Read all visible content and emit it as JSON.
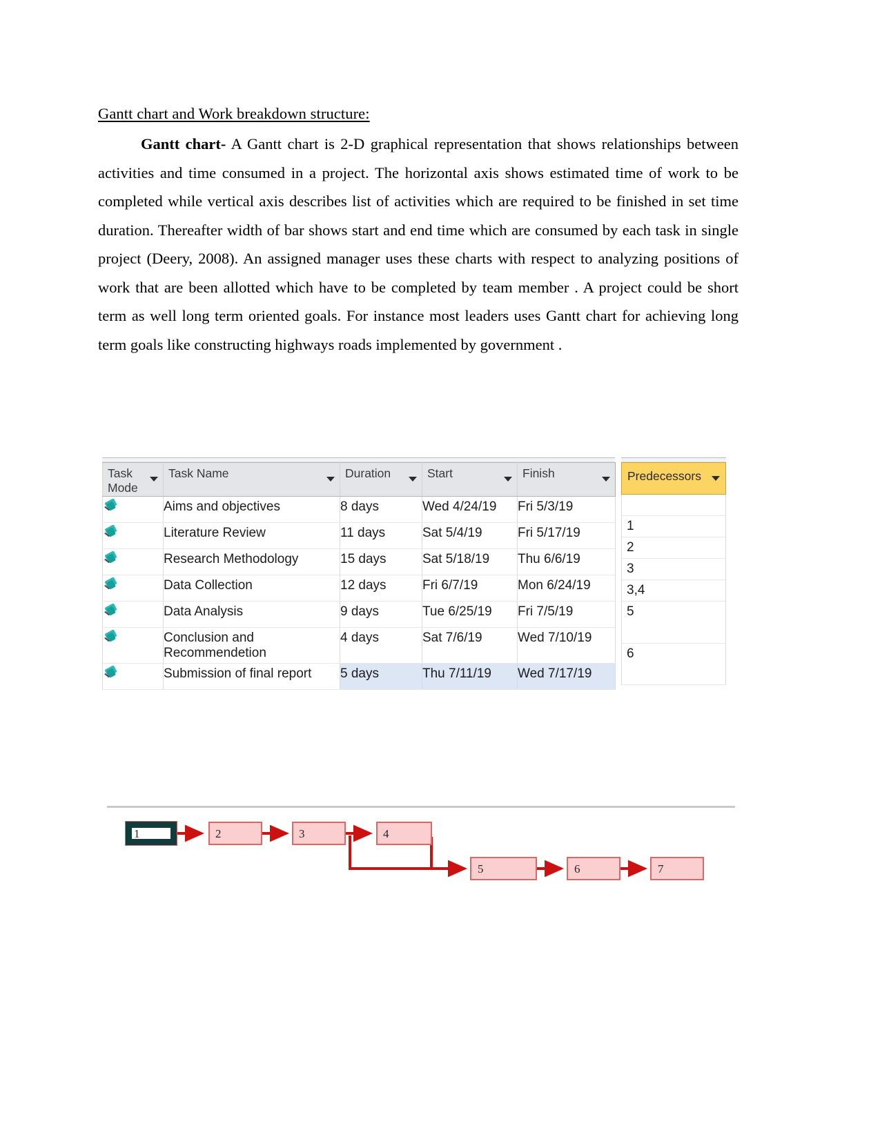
{
  "document": {
    "heading": "Gantt chart and Work breakdown structure:",
    "paragraph_lead_in": "Gantt chart-",
    "paragraph_body": "  A Gantt chart is 2-D graphical representation that shows  relationships between activities   and time consumed in a project. The horizontal axis shows estimated time of work to be completed while  vertical axis describes list of activities which are required  to be finished in set time duration. Thereafter width of bar shows start and end  time which are consumed by each task  in single project (Deery, 2008). An assigned manager uses these charts with respect to analyzing positions of work that are been allotted which have to be completed by team member . A project could be short term as well long term oriented goals. For instance most leaders uses Gantt chart for achieving long term goals like constructing highways roads implemented by government ."
  },
  "gantt_table": {
    "columns": [
      {
        "key": "task_mode",
        "label": "Task\nMode",
        "highlighted": false,
        "has_filter": true
      },
      {
        "key": "task_name",
        "label": "Task Name",
        "highlighted": false,
        "has_filter": true
      },
      {
        "key": "duration",
        "label": "Duration",
        "highlighted": false,
        "has_filter": true
      },
      {
        "key": "start",
        "label": "Start",
        "highlighted": false,
        "has_filter": true
      },
      {
        "key": "finish",
        "label": "Finish",
        "highlighted": true,
        "has_filter": true
      }
    ],
    "predecessors_column": {
      "label": "Predecessors",
      "highlighted": true,
      "has_filter": true
    },
    "rows": [
      {
        "mode_icon": "pushpin-icon",
        "task_name": "Aims and objectives",
        "duration": "8 days",
        "start": "Wed 4/24/19",
        "finish": "Fri 5/3/19",
        "predecessors": "",
        "selected": false
      },
      {
        "mode_icon": "pushpin-icon",
        "task_name": "Literature Review",
        "duration": "11 days",
        "start": "Sat 5/4/19",
        "finish": "Fri 5/17/19",
        "predecessors": "1",
        "selected": false
      },
      {
        "mode_icon": "pushpin-icon",
        "task_name": "Research Methodology",
        "duration": "15 days",
        "start": "Sat 5/18/19",
        "finish": "Thu 6/6/19",
        "predecessors": "2",
        "selected": false
      },
      {
        "mode_icon": "pushpin-icon",
        "task_name": "Data Collection",
        "duration": "12 days",
        "start": "Fri 6/7/19",
        "finish": "Mon 6/24/19",
        "predecessors": "3",
        "selected": false
      },
      {
        "mode_icon": "pushpin-icon",
        "task_name": "Data Analysis",
        "duration": "9 days",
        "start": "Tue 6/25/19",
        "finish": "Fri 7/5/19",
        "predecessors": "3,4",
        "selected": false
      },
      {
        "mode_icon": "pushpin-icon",
        "task_name": "Conclusion and Recommendetion",
        "duration": "4 days",
        "start": "Sat 7/6/19",
        "finish": "Wed 7/10/19",
        "predecessors": "5",
        "selected": false
      },
      {
        "mode_icon": "pushpin-icon",
        "task_name": "Submission of final report",
        "duration": "5 days",
        "start": "Thu 7/11/19",
        "finish": "Wed 7/17/19",
        "predecessors": "6",
        "selected": true
      }
    ]
  },
  "network_diagram": {
    "nodes": [
      {
        "id": "1",
        "label": "1",
        "selected": true
      },
      {
        "id": "2",
        "label": "2",
        "selected": false
      },
      {
        "id": "3",
        "label": "3",
        "selected": false
      },
      {
        "id": "4",
        "label": "4",
        "selected": false
      },
      {
        "id": "5",
        "label": "5",
        "selected": false
      },
      {
        "id": "6",
        "label": "6",
        "selected": false
      },
      {
        "id": "7",
        "label": "7",
        "selected": false
      }
    ],
    "edges": [
      {
        "from": "1",
        "to": "2"
      },
      {
        "from": "2",
        "to": "3"
      },
      {
        "from": "3",
        "to": "4"
      },
      {
        "from": "3",
        "to": "5"
      },
      {
        "from": "4",
        "to": "5"
      },
      {
        "from": "5",
        "to": "6"
      },
      {
        "from": "6",
        "to": "7"
      }
    ]
  },
  "colors": {
    "header_highlight": "#fcd462",
    "header_grey": "#e3e5e8",
    "row_selected": "#dce6f4",
    "pin_icon": "#2fb9b4",
    "node_fill": "#fbcfcf",
    "node_stroke": "#e06666",
    "edge": "#cc1111",
    "node_selected_border": "#0f3c3c"
  }
}
